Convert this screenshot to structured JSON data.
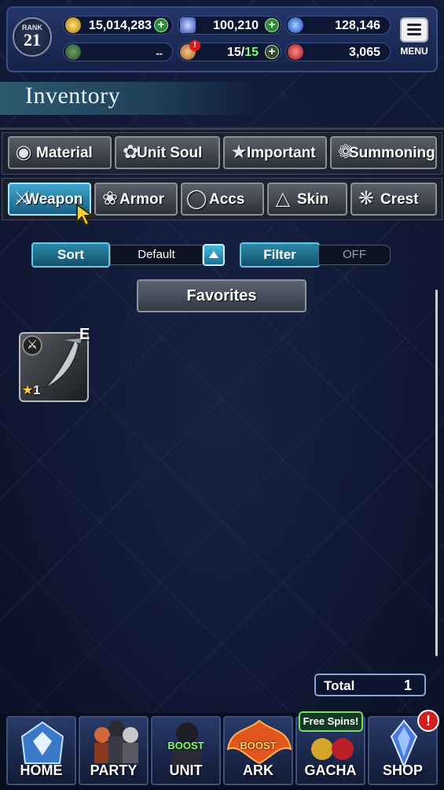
{
  "rank": {
    "label": "RANK",
    "value": "21"
  },
  "currencies": {
    "gil": "15,014,283",
    "lapis": "100,210",
    "orb": "128,146",
    "ark_empty": "--",
    "energy": "15",
    "energy_max": "15",
    "red_orb": "3,065"
  },
  "menu_label": "MENU",
  "header": {
    "title": "Inventory"
  },
  "tabs_row1": [
    {
      "label": "Material",
      "icon": "sack-icon"
    },
    {
      "label": "Unit Soul",
      "icon": "soul-flame-icon"
    },
    {
      "label": "Important",
      "icon": "star-icon"
    },
    {
      "label": "Summoning",
      "icon": "summon-crest-icon"
    }
  ],
  "tabs_row2": [
    {
      "label": "Weapon",
      "icon": "sword-icon",
      "active": true
    },
    {
      "label": "Armor",
      "icon": "armor-icon"
    },
    {
      "label": "Accs",
      "icon": "necklace-icon"
    },
    {
      "label": "Skin",
      "icon": "hanger-icon"
    },
    {
      "label": "Crest",
      "icon": "crest-icon"
    }
  ],
  "sort": {
    "label": "Sort",
    "value": "Default"
  },
  "filter": {
    "label": "Filter",
    "value": "OFF"
  },
  "favorites_label": "Favorites",
  "item": {
    "rank_letter": "E",
    "stars": "1",
    "type_icon": "sword-icon"
  },
  "total": {
    "label": "Total",
    "value": "1"
  },
  "nav": [
    {
      "label": "HOME"
    },
    {
      "label": "PARTY"
    },
    {
      "label": "UNIT",
      "boost": "BOOST"
    },
    {
      "label": "ARK",
      "boost": "BOOST"
    },
    {
      "label": "GACHA",
      "tag": "Free Spins!"
    },
    {
      "label": "SHOP",
      "badge": "!"
    }
  ]
}
